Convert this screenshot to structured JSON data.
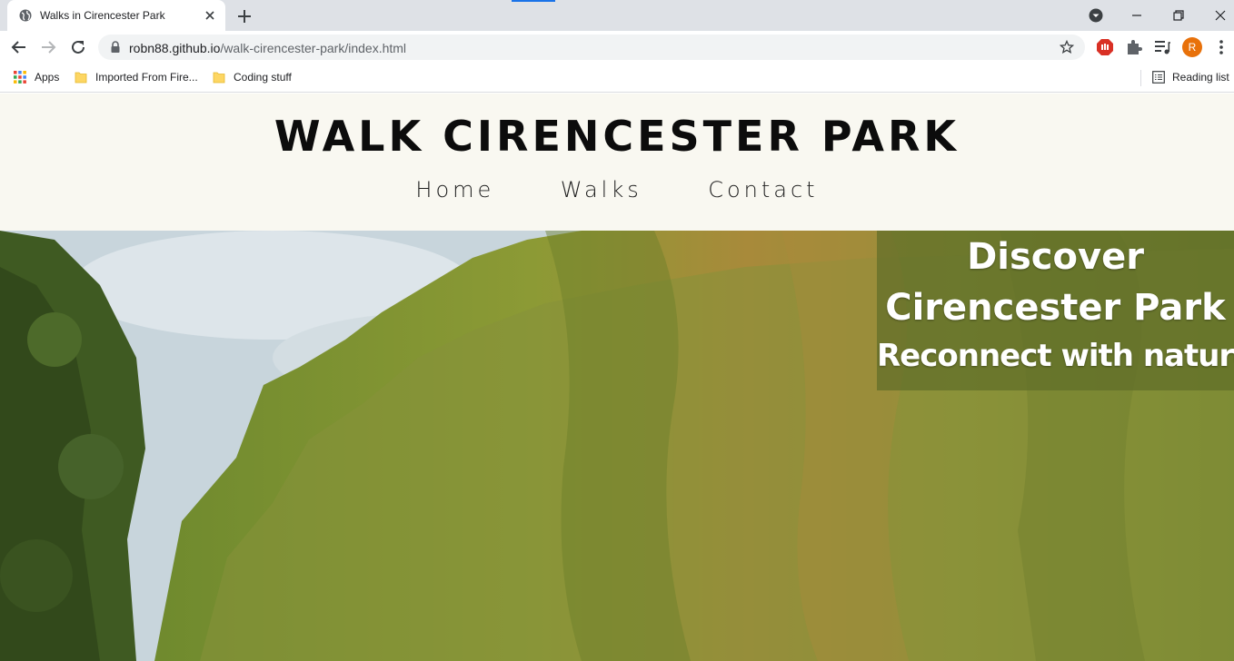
{
  "browser": {
    "tab": {
      "title": "Walks in Cirencester Park"
    },
    "url": {
      "host": "robn88.github.io",
      "path": "/walk-cirencester-park/index.html"
    },
    "profile_initial": "R",
    "bookmarks": [
      {
        "label": "Apps",
        "icon": "apps-grid-icon"
      },
      {
        "label": "Imported From Fire...",
        "icon": "folder-icon"
      },
      {
        "label": "Coding stuff",
        "icon": "folder-icon"
      }
    ],
    "reading_list": {
      "label": "Reading list",
      "icon": "reading-list-icon"
    },
    "colors": {
      "tabstrip": "#dee1e6",
      "omnibox": "#f1f3f4",
      "avatar": "#e8710a",
      "accent": "#1a73e8"
    }
  },
  "site": {
    "title": "WALK CIRENCESTER PARK",
    "nav": [
      "Home",
      "Walks",
      "Contact"
    ],
    "header_bg": "#f9f8f1",
    "hero": {
      "line1": "Discover",
      "line2": "Cirencester Park",
      "line3": "Reconnect with nature"
    }
  }
}
